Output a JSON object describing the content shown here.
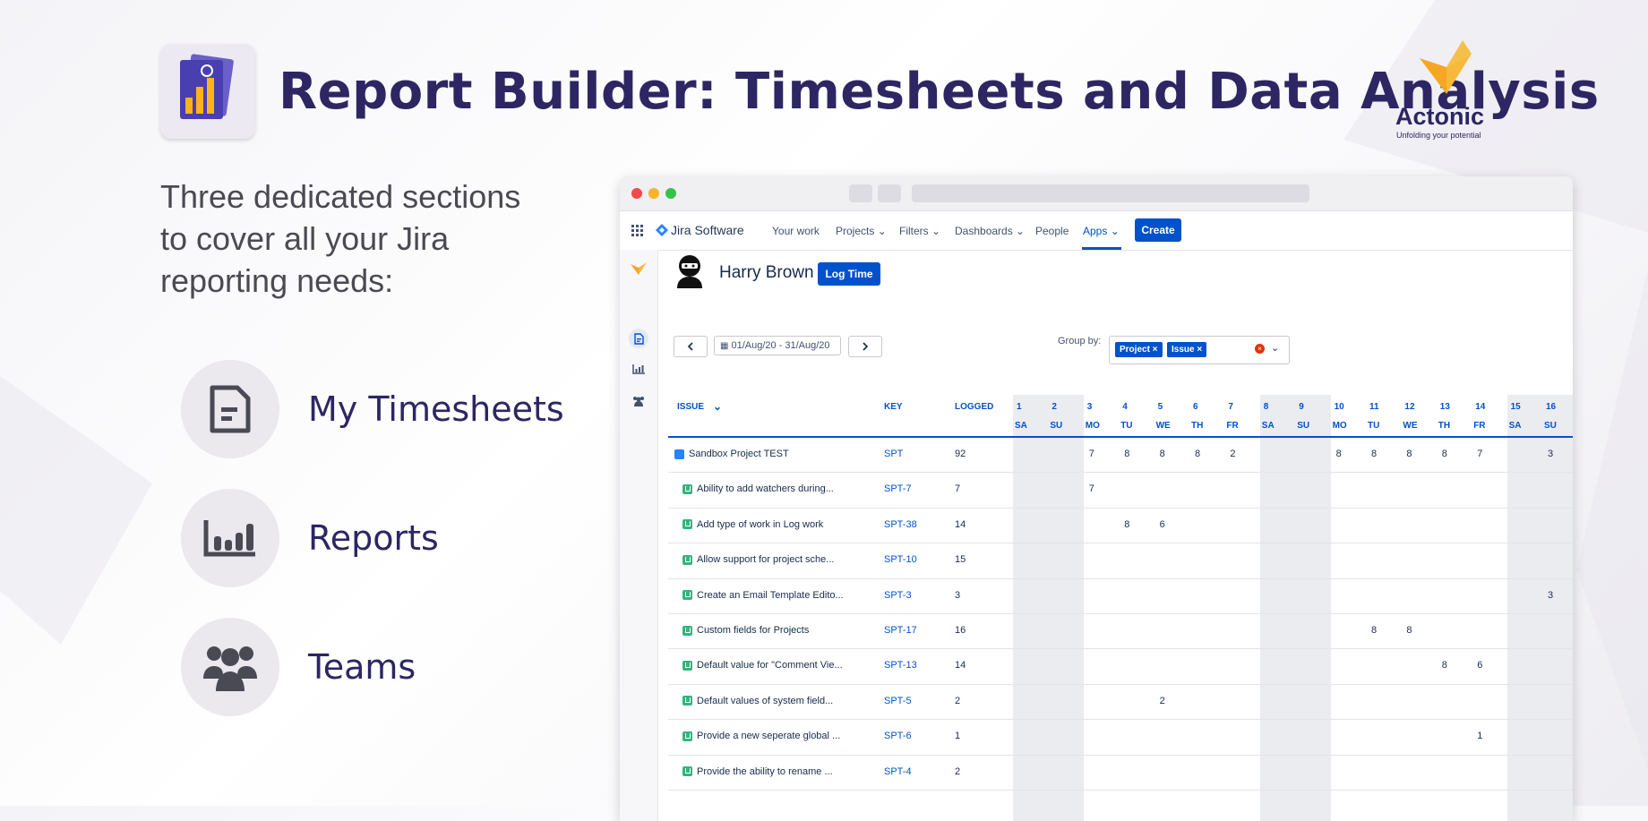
{
  "hero": {
    "title": "Report Builder: Timesheets and Data Analysis",
    "intro": "Three dedicated sections to cover all your Jira reporting needs:",
    "features": [
      {
        "label": "My Timesheets",
        "icon": "document-icon"
      },
      {
        "label": "Reports",
        "icon": "bar-chart-icon"
      },
      {
        "label": "Teams",
        "icon": "team-icon"
      }
    ]
  },
  "brand": {
    "name": "Actonic",
    "tagline": "Unfolding your potential"
  },
  "colors": {
    "brand": "#2d2663",
    "jira_blue": "#0052cc",
    "story_green": "#36b37e",
    "weekend": "#ebecf0"
  },
  "jira": {
    "product": "Jira Software",
    "nav": [
      "Your work",
      "Projects",
      "Filters",
      "Dashboards",
      "People",
      "Apps"
    ],
    "create": "Create"
  },
  "user": {
    "name": "Harry Brown",
    "log_time": "Log Time"
  },
  "toolbar": {
    "date_range": "01/Aug/20 - 31/Aug/20",
    "group_by_label": "Group by:",
    "chips": [
      "Project",
      "Issue"
    ]
  },
  "table": {
    "columns": {
      "issue": "ISSUE",
      "key": "KEY",
      "logged": "LOGGED"
    },
    "days": [
      {
        "num": "1",
        "dow": "SA"
      },
      {
        "num": "2",
        "dow": "SU"
      },
      {
        "num": "3",
        "dow": "MO"
      },
      {
        "num": "4",
        "dow": "TU"
      },
      {
        "num": "5",
        "dow": "WE"
      },
      {
        "num": "6",
        "dow": "TH"
      },
      {
        "num": "7",
        "dow": "FR"
      },
      {
        "num": "8",
        "dow": "SA"
      },
      {
        "num": "9",
        "dow": "SU"
      },
      {
        "num": "10",
        "dow": "MO"
      },
      {
        "num": "11",
        "dow": "TU"
      },
      {
        "num": "12",
        "dow": "WE"
      },
      {
        "num": "13",
        "dow": "TH"
      },
      {
        "num": "14",
        "dow": "FR"
      },
      {
        "num": "15",
        "dow": "SA"
      },
      {
        "num": "16",
        "dow": "SU"
      }
    ],
    "rows": [
      {
        "issue": "Sandbox Project TEST",
        "type": "project",
        "key": "SPT",
        "logged": "92",
        "cells": {
          "3": "7",
          "4": "8",
          "5": "8",
          "6": "8",
          "7": "2",
          "10": "8",
          "11": "8",
          "12": "8",
          "13": "8",
          "14": "7",
          "16": "3"
        }
      },
      {
        "issue": "Ability to add watchers during...",
        "type": "story",
        "key": "SPT-7",
        "logged": "7",
        "cells": {
          "3": "7"
        }
      },
      {
        "issue": "Add type of work in Log work",
        "type": "story",
        "key": "SPT-38",
        "logged": "14",
        "cells": {
          "4": "8",
          "5": "6"
        }
      },
      {
        "issue": "Allow support for project sche...",
        "type": "story",
        "key": "SPT-10",
        "logged": "15",
        "cells": {}
      },
      {
        "issue": "Create an Email Template Edito...",
        "type": "story",
        "key": "SPT-3",
        "logged": "3",
        "cells": {
          "16": "3"
        }
      },
      {
        "issue": "Custom fields for Projects",
        "type": "story",
        "key": "SPT-17",
        "logged": "16",
        "cells": {
          "11": "8",
          "12": "8"
        }
      },
      {
        "issue": "Default value for \"Comment Vie...",
        "type": "story",
        "key": "SPT-13",
        "logged": "14",
        "cells": {
          "13": "8",
          "14": "6"
        }
      },
      {
        "issue": "Default values of system field...",
        "type": "story",
        "key": "SPT-5",
        "logged": "2",
        "cells": {
          "5": "2"
        }
      },
      {
        "issue": "Provide a new seperate global ...",
        "type": "story",
        "key": "SPT-6",
        "logged": "1",
        "cells": {
          "14": "1"
        }
      },
      {
        "issue": "Provide the ability to rename ...",
        "type": "story",
        "key": "SPT-4",
        "logged": "2",
        "cells": {}
      }
    ]
  }
}
